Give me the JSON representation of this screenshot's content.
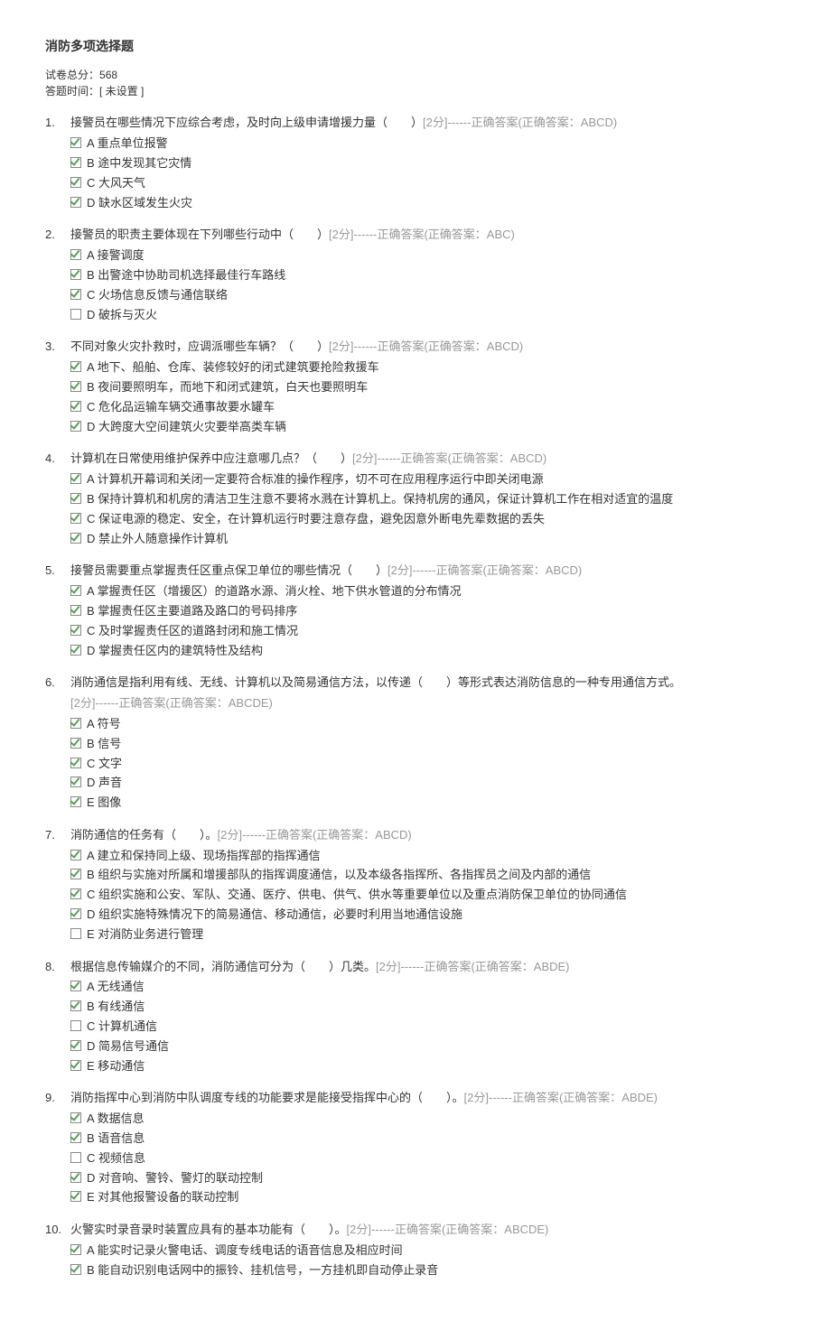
{
  "title": "消防多项选择题",
  "meta": {
    "total_label": "试卷总分：",
    "total_value": "568",
    "time_label": "答题时间：",
    "time_value": "[ 未设置 ]"
  },
  "score_prefix": "[",
  "score_suffix": "分]",
  "answer_prefix": "------正确答案(正确答案：",
  "answer_suffix": ")",
  "questions": [
    {
      "num": "1.",
      "text": "接警员在哪些情况下应综合考虑，及时向上级申请增援力量（　　）",
      "score": "2",
      "answer": "ABCD",
      "options": [
        {
          "checked": true,
          "label": "A 重点单位报警"
        },
        {
          "checked": true,
          "label": "B 途中发现其它灾情"
        },
        {
          "checked": true,
          "label": "C 大风天气"
        },
        {
          "checked": true,
          "label": "D 缺水区域发生火灾"
        }
      ]
    },
    {
      "num": "2.",
      "text": "接警员的职责主要体现在下列哪些行动中（　　）",
      "score": "2",
      "answer": "ABC",
      "options": [
        {
          "checked": true,
          "label": "A 接警调度"
        },
        {
          "checked": true,
          "label": "B 出警途中协助司机选择最佳行车路线"
        },
        {
          "checked": true,
          "label": "C 火场信息反馈与通信联络"
        },
        {
          "checked": false,
          "label": "D 破拆与灭火"
        }
      ]
    },
    {
      "num": "3.",
      "text": "不同对象火灾扑救时，应调派哪些车辆？（　　）",
      "score": "2",
      "answer": "ABCD",
      "options": [
        {
          "checked": true,
          "label": "A 地下、船舶、仓库、装修较好的闭式建筑要抢险救援车"
        },
        {
          "checked": true,
          "label": "B 夜间要照明车，而地下和闭式建筑，白天也要照明车"
        },
        {
          "checked": true,
          "label": "C 危化品运输车辆交通事故要水罐车"
        },
        {
          "checked": true,
          "label": "D 大跨度大空间建筑火灾要举高类车辆"
        }
      ]
    },
    {
      "num": "4.",
      "text": "计算机在日常使用维护保养中应注意哪几点？（　　）",
      "score": "2",
      "answer": "ABCD",
      "options": [
        {
          "checked": true,
          "label": "A 计算机开幕词和关闭一定要符合标准的操作程序，切不可在应用程序运行中即关闭电源"
        },
        {
          "checked": true,
          "label": "B 保持计算机和机房的清洁卫生注意不要将水溅在计算机上。保持机房的通风，保证计算机工作在相对适宜的温度"
        },
        {
          "checked": true,
          "label": "C 保证电源的稳定、安全，在计算机运行时要注意存盘，避免因意外断电先辈数据的丢失"
        },
        {
          "checked": true,
          "label": "D 禁止外人随意操作计算机"
        }
      ]
    },
    {
      "num": "5.",
      "text": "接警员需要重点掌握责任区重点保卫单位的哪些情况（　　）",
      "score": "2",
      "answer": "ABCD",
      "options": [
        {
          "checked": true,
          "label": "A 掌握责任区（增援区）的道路水源、消火栓、地下供水管道的分布情况"
        },
        {
          "checked": true,
          "label": "B 掌握责任区主要道路及路口的号码排序"
        },
        {
          "checked": true,
          "label": "C 及时掌握责任区的道路封闭和施工情况"
        },
        {
          "checked": true,
          "label": "D 掌握责任区内的建筑特性及结构"
        }
      ]
    },
    {
      "num": "6.",
      "text": "消防通信是指利用有线、无线、计算机以及简易通信方法，以传递（　　）等形式表达消防信息的一种专用通信方式。",
      "score": "2",
      "answer": "ABCDE",
      "answer_newline": true,
      "options": [
        {
          "checked": true,
          "label": "A 符号"
        },
        {
          "checked": true,
          "label": "B 信号"
        },
        {
          "checked": true,
          "label": "C 文字"
        },
        {
          "checked": true,
          "label": "D 声音"
        },
        {
          "checked": true,
          "label": "E 图像"
        }
      ]
    },
    {
      "num": "7.",
      "text": "消防通信的任务有（　　）。",
      "score": "2",
      "answer": "ABCD",
      "options": [
        {
          "checked": true,
          "label": "A 建立和保持同上级、现场指挥部的指挥通信"
        },
        {
          "checked": true,
          "label": "B 组织与实施对所属和增援部队的指挥调度通信，以及本级各指挥所、各指挥员之间及内部的通信"
        },
        {
          "checked": true,
          "label": "C 组织实施和公安、军队、交通、医疗、供电、供气、供水等重要单位以及重点消防保卫单位的协同通信"
        },
        {
          "checked": true,
          "label": "D 组织实施特殊情况下的简易通信、移动通信，必要时利用当地通信设施"
        },
        {
          "checked": false,
          "label": "E 对消防业务进行管理"
        }
      ]
    },
    {
      "num": "8.",
      "text": "根据信息传输媒介的不同，消防通信可分为（　　）几类。",
      "score": "2",
      "answer": "ABDE",
      "options": [
        {
          "checked": true,
          "label": "A 无线通信"
        },
        {
          "checked": true,
          "label": "B 有线通信"
        },
        {
          "checked": false,
          "label": "C 计算机通信"
        },
        {
          "checked": true,
          "label": "D 简易信号通信"
        },
        {
          "checked": true,
          "label": "E 移动通信"
        }
      ]
    },
    {
      "num": "9.",
      "text": "消防指挥中心到消防中队调度专线的功能要求是能接受指挥中心的（　　）。",
      "score": "2",
      "answer": "ABDE",
      "options": [
        {
          "checked": true,
          "label": "A 数据信息"
        },
        {
          "checked": true,
          "label": "B 语音信息"
        },
        {
          "checked": false,
          "label": "C 视频信息"
        },
        {
          "checked": true,
          "label": "D 对音响、警铃、警灯的联动控制"
        },
        {
          "checked": true,
          "label": "E 对其他报警设备的联动控制"
        }
      ]
    },
    {
      "num": "10.",
      "text": "火警实时录音录时装置应具有的基本功能有（　　）。",
      "score": "2",
      "answer": "ABCDE",
      "options": [
        {
          "checked": true,
          "label": "A 能实时记录火警电话、调度专线电话的语音信息及相应时间"
        },
        {
          "checked": true,
          "label": "B 能自动识别电话网中的振铃、挂机信号，一方挂机即自动停止录音"
        }
      ]
    }
  ]
}
